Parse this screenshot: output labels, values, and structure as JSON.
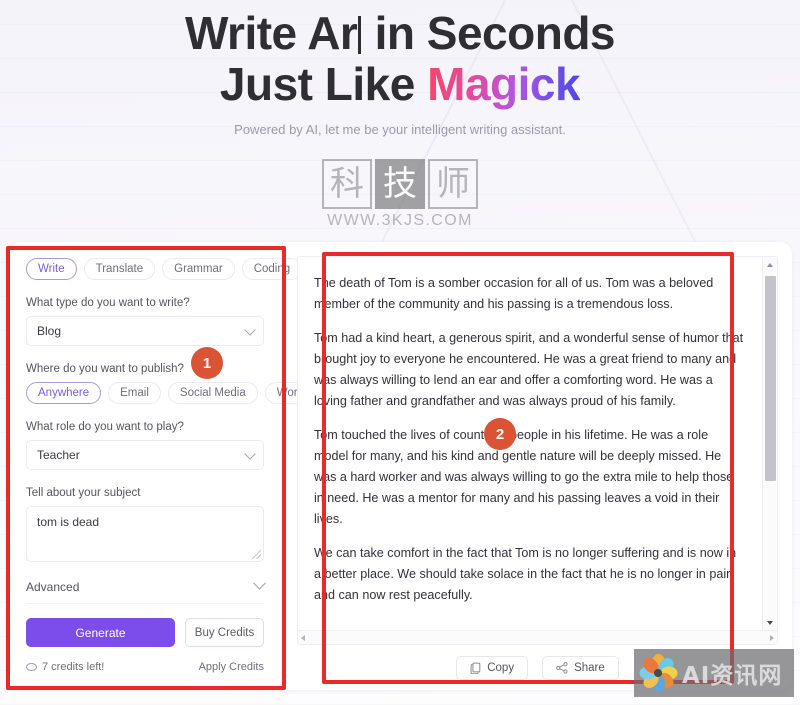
{
  "hero": {
    "title_line1_before": "Write Ar",
    "title_line1_after": " in Seconds",
    "title_line2_plain": "Just Like ",
    "title_line2_accent": "Magick",
    "subtitle": "Powered by AI, let me be your intelligent writing assistant.",
    "accent_gradient_from": "#f2476a",
    "accent_gradient_to": "#4f46e5"
  },
  "watermark_logo": {
    "char1": "科",
    "char2": "技",
    "char3": "师",
    "url": "WWW.3KJS.COM"
  },
  "watermark_corner": {
    "text": "AI资讯网"
  },
  "left_panel": {
    "mode_tabs": [
      {
        "label": "Write",
        "active": true
      },
      {
        "label": "Translate",
        "active": false
      },
      {
        "label": "Grammar",
        "active": false
      },
      {
        "label": "Coding",
        "active": false
      }
    ],
    "type_label": "What type do you want to write?",
    "type_value": "Blog",
    "publish_label": "Where do you want to publish?",
    "publish_options": [
      {
        "label": "Anywhere",
        "active": true
      },
      {
        "label": "Email",
        "active": false
      },
      {
        "label": "Social Media",
        "active": false
      },
      {
        "label": "Work",
        "active": false
      }
    ],
    "role_label": "What role do you want to play?",
    "role_value": "Teacher",
    "subject_label": "Tell about your subject",
    "subject_value": "tom is dead",
    "subject_placeholder": "Tell about your subject",
    "advanced_label": "Advanced",
    "generate_label": "Generate",
    "buy_credits_label": "Buy Credits",
    "credits_text": "7 credits left!",
    "apply_credits_label": "Apply Credits",
    "generate_color": "#7c4dea",
    "active_pill_color": "#7b5ce0"
  },
  "output": {
    "paragraphs": [
      "The death of Tom is a somber occasion for all of us. Tom was a beloved member of the community and his passing is a tremendous loss.",
      "Tom had a kind heart, a generous spirit, and a wonderful sense of humor that brought joy to everyone he encountered. He was a great friend to many and was always willing to lend an ear and offer a comforting word. He was a loving father and grandfather and was always proud of his family.",
      "Tom touched the lives of countless people in his lifetime. He was a role model for many, and his kind and gentle nature will be deeply missed. He was a hard worker and was always willing to go the extra mile to help those in need. He was a mentor for many and his passing leaves a void in their lives.",
      "We can take comfort in the fact that Tom is no longer suffering and is now in a better place. We should take solace in the fact that he is no longer in pain and can now rest peacefully."
    ],
    "copy_label": "Copy",
    "share_label": "Share"
  },
  "annotations": {
    "box_color": "#e82a29",
    "badge_color": "#da5334",
    "badges": [
      {
        "number": "1"
      },
      {
        "number": "2"
      }
    ]
  }
}
